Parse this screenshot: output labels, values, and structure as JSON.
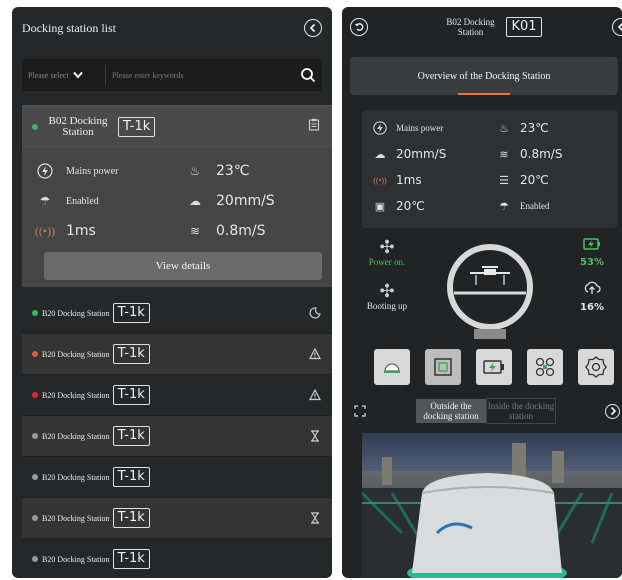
{
  "left_panel": {
    "title": "Docking station list",
    "search": {
      "select_label": "Please select",
      "placeholder": "Please enter keywords"
    },
    "selected_card": {
      "name": "B02 Docking Station",
      "tag": "T-1k",
      "status_color": "#2fc05b",
      "stats": [
        {
          "icon": "bolt-icon",
          "value": "Mains power"
        },
        {
          "icon": "heat-icon",
          "value": "23℃"
        },
        {
          "icon": "weather-station-icon",
          "value": "Enabled"
        },
        {
          "icon": "wind-icon",
          "value": "20mm/S"
        },
        {
          "icon": "signal-icon",
          "value": "1ms"
        },
        {
          "icon": "wind-speed-icon",
          "value": "0.8m/S"
        }
      ],
      "view_details": "View details"
    },
    "stations": [
      {
        "name": "B20 Docking Station",
        "tag": "T-1k",
        "color": "#2fc05b",
        "status_icon": "moon-icon"
      },
      {
        "name": "B20 Docking Station",
        "tag": "T-1k",
        "color": "#e15a3a",
        "status_icon": "warning-icon"
      },
      {
        "name": "B20 Docking Station",
        "tag": "T-1k",
        "color": "#e02a2a",
        "status_icon": "warning-icon"
      },
      {
        "name": "B20 Docking Station",
        "tag": "T-1k",
        "color": "#9a9a9a",
        "status_icon": "hourglass-icon"
      },
      {
        "name": "B20 Docking Station",
        "tag": "T-1k",
        "color": "#9a9a9a",
        "status_icon": ""
      },
      {
        "name": "B20 Docking Station",
        "tag": "T-1k",
        "color": "#9a9a9a",
        "status_icon": "hourglass-icon"
      },
      {
        "name": "B20 Docking Station",
        "tag": "T-1k",
        "color": "#9a9a9a",
        "status_icon": ""
      }
    ]
  },
  "right_panel": {
    "title": "B02 Docking Station",
    "tag": "K01",
    "tab": "Overview of the Docking Station",
    "stats": {
      "mains_power": "Mains power",
      "heat": "23℃",
      "rain": "20mm/S",
      "wind": "0.8m/S",
      "signal": "1ms",
      "ac_temp": "20℃",
      "battery_temp": "20℃",
      "weather": "Enabled"
    },
    "power": {
      "drone_status": "Power on.",
      "battery": "53%",
      "booting": "Booting up",
      "upload": "16%"
    },
    "camera": {
      "tab_outside": "Outside the docking station",
      "tab_inside": "Inside the docking station"
    }
  }
}
